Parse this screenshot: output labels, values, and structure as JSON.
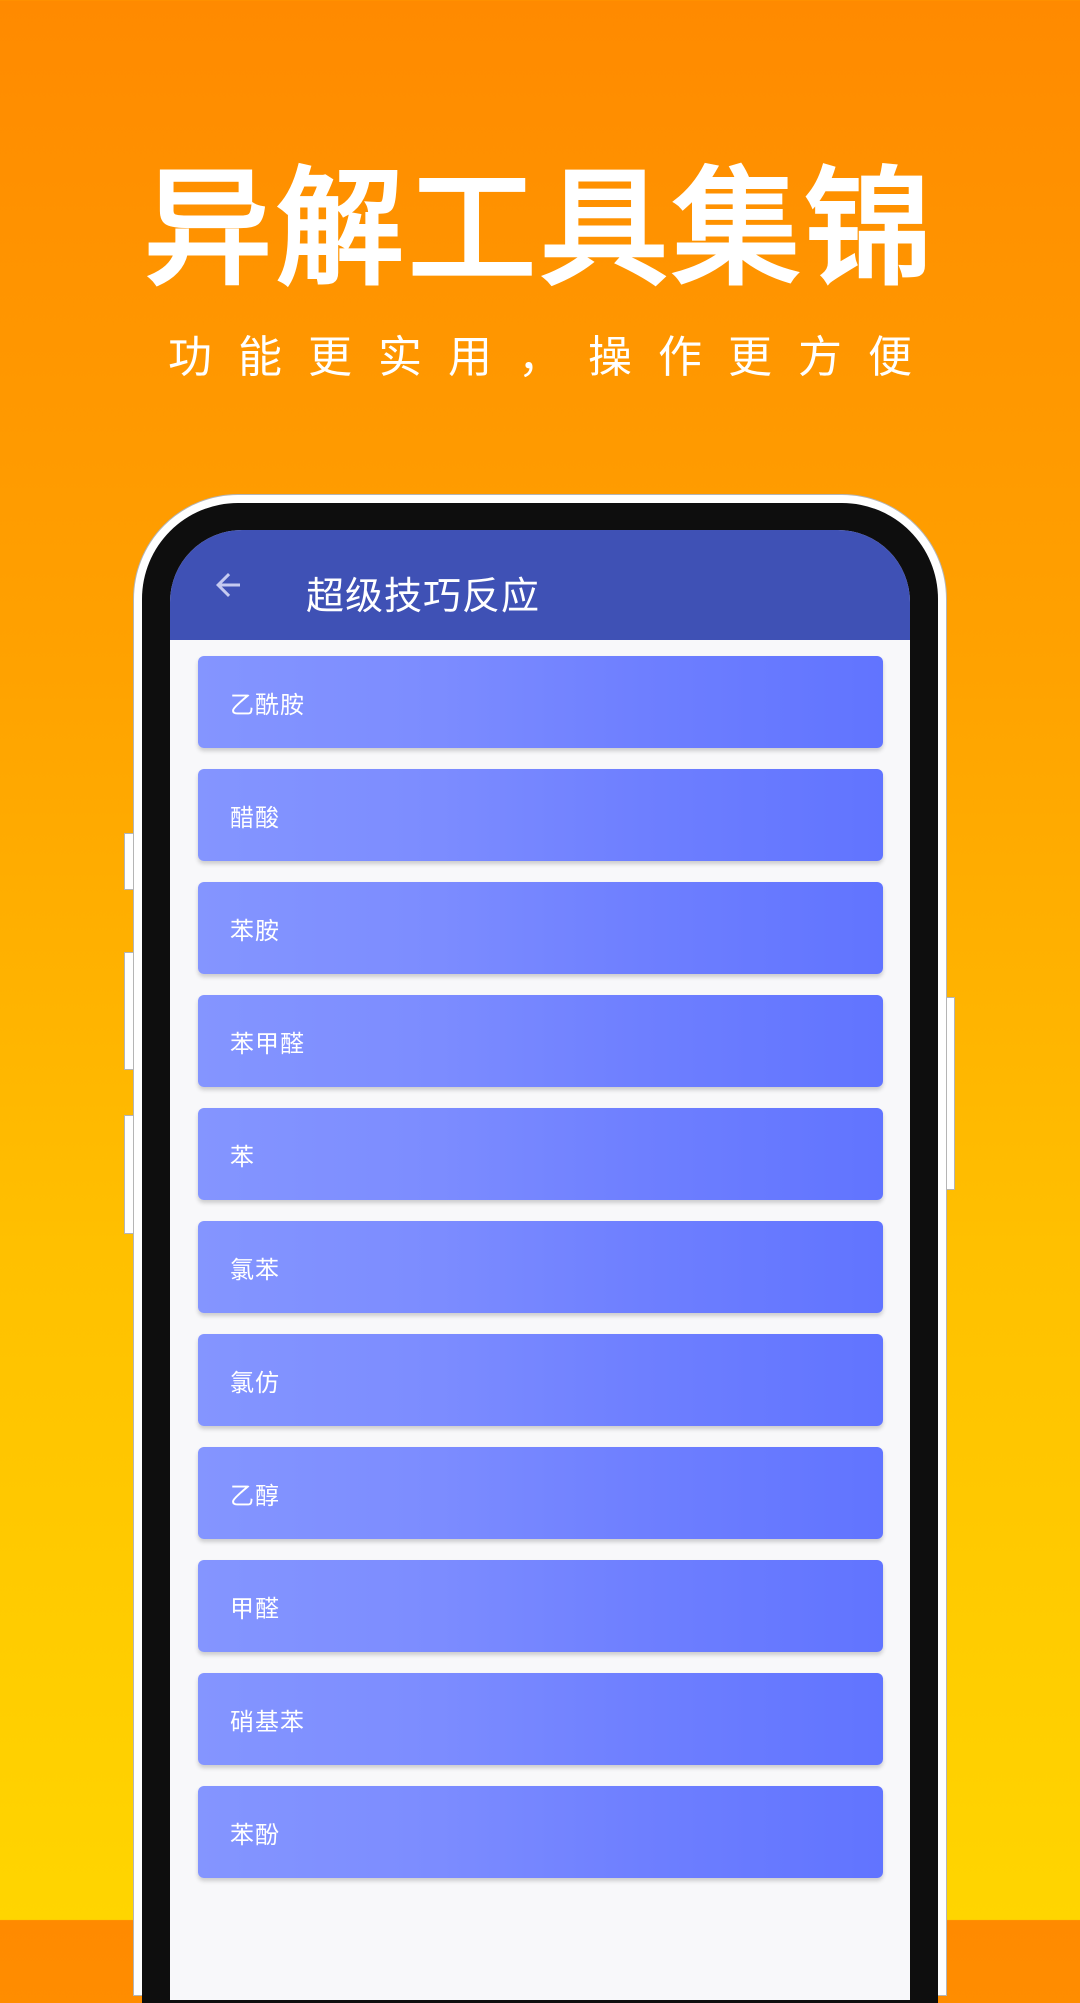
{
  "promo": {
    "headline": "异解工具集锦",
    "subline": "功能更实用，操作更方便"
  },
  "app": {
    "title": "超级技巧反应",
    "back_icon": "arrow-left-icon",
    "colors": {
      "appbar": "#3F51B5",
      "item_gradient_start": "#8495FF",
      "item_gradient_end": "#6174FF",
      "background_top": "#FF8A00",
      "background_bottom": "#FFD500"
    },
    "items": [
      {
        "label": "乙酰胺"
      },
      {
        "label": "醋酸"
      },
      {
        "label": "苯胺"
      },
      {
        "label": "苯甲醛"
      },
      {
        "label": "苯"
      },
      {
        "label": "氯苯"
      },
      {
        "label": "氯仿"
      },
      {
        "label": "乙醇"
      },
      {
        "label": "甲醛"
      },
      {
        "label": "硝基苯"
      },
      {
        "label": "苯酚"
      }
    ]
  }
}
